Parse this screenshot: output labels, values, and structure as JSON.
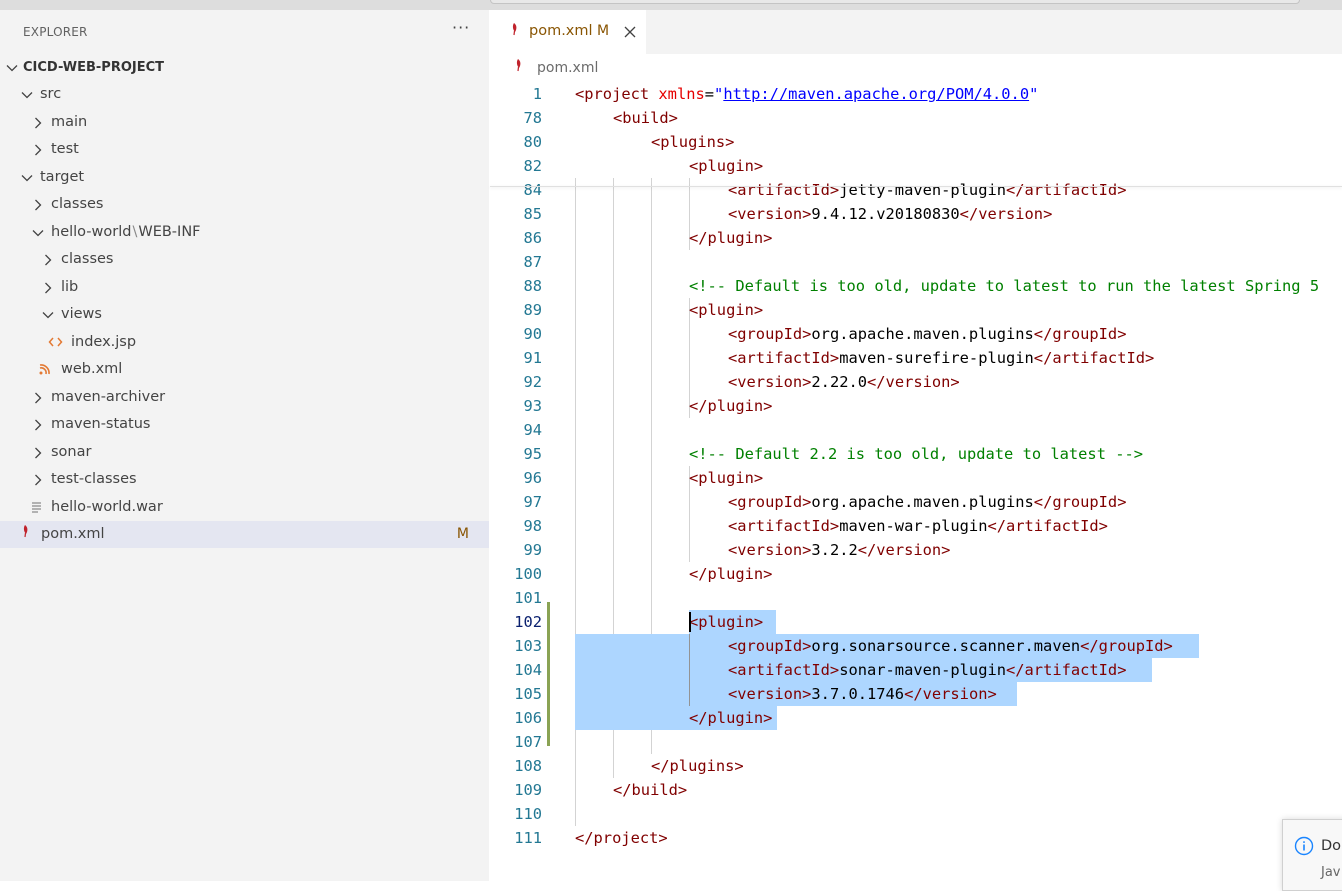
{
  "explorer": {
    "title": "EXPLORER",
    "more": "···",
    "project": "CICD-WEB-PROJECT",
    "tree": [
      {
        "label": "src"
      },
      {
        "label": "main"
      },
      {
        "label": "test"
      },
      {
        "label": "target"
      },
      {
        "label": "classes"
      },
      {
        "label": "hello-world",
        "label2": "WEB-INF",
        "sep": "\\"
      },
      {
        "label": "classes"
      },
      {
        "label": "lib"
      },
      {
        "label": "views"
      },
      {
        "label": "index.jsp"
      },
      {
        "label": "web.xml"
      },
      {
        "label": "maven-archiver"
      },
      {
        "label": "maven-status"
      },
      {
        "label": "sonar"
      },
      {
        "label": "test-classes"
      },
      {
        "label": "hello-world.war"
      },
      {
        "label": "pom.xml",
        "badge": "M"
      }
    ]
  },
  "tab": {
    "label": "pom.xml",
    "modified": "M"
  },
  "breadcrumb": "pom.xml",
  "code": {
    "line_numbers": [
      "1",
      "78",
      "80",
      "82",
      "84",
      "85",
      "86",
      "87",
      "88",
      "89",
      "90",
      "91",
      "92",
      "93",
      "94",
      "95",
      "96",
      "97",
      "98",
      "99",
      "100",
      "101",
      "102",
      "103",
      "104",
      "105",
      "106",
      "107",
      "108",
      "109",
      "110",
      "111"
    ],
    "l1_open": "<project ",
    "l1_attr": "xmlns",
    "l1_eq": "=",
    "l1_q": "\"",
    "l1_url": "http://maven.apache.org/POM/4.0.0",
    "l78": "<build>",
    "l80": "<plugins>",
    "l82": "<plugin>",
    "l84_a": "<artifactId>",
    "l84_v": "jetty-maven-plugin",
    "l84_b": "</artifactId>",
    "l85_a": "<version>",
    "l85_v": "9.4.12.v20180830",
    "l85_b": "</version>",
    "l86": "</plugin>",
    "l88": "<!-- Default is too old, update to latest to run the latest Spring 5",
    "l89": "<plugin>",
    "l90_a": "<groupId>",
    "l90_v": "org.apache.maven.plugins",
    "l90_b": "</groupId>",
    "l91_a": "<artifactId>",
    "l91_v": "maven-surefire-plugin",
    "l91_b": "</artifactId>",
    "l92_a": "<version>",
    "l92_v": "2.22.0",
    "l92_b": "</version>",
    "l93": "</plugin>",
    "l95": "<!-- Default 2.2 is too old, update to latest -->",
    "l96": "<plugin>",
    "l97_a": "<groupId>",
    "l97_v": "org.apache.maven.plugins",
    "l97_b": "</groupId>",
    "l98_a": "<artifactId>",
    "l98_v": "maven-war-plugin",
    "l98_b": "</artifactId>",
    "l99_a": "<version>",
    "l99_v": "3.2.2",
    "l99_b": "</version>",
    "l100": "</plugin>",
    "l102": "<plugin>",
    "l103_a": "<groupId>",
    "l103_v": "org.sonarsource.scanner.maven",
    "l103_b": "</groupId>",
    "l104_a": "<artifactId>",
    "l104_v": "sonar-maven-plugin",
    "l104_b": "</artifactId>",
    "l105_a": "<version>",
    "l105_v": "3.7.0.1746",
    "l105_b": "</version>",
    "l106": "</plugin>",
    "l108": "</plugins>",
    "l109": "</build>",
    "l111": "</project>"
  },
  "notification": {
    "text": "Do",
    "sub": "Jav"
  },
  "colors": {
    "accent": "#895503",
    "selection": "#add6ff",
    "gutter_added": "#587c0c"
  }
}
